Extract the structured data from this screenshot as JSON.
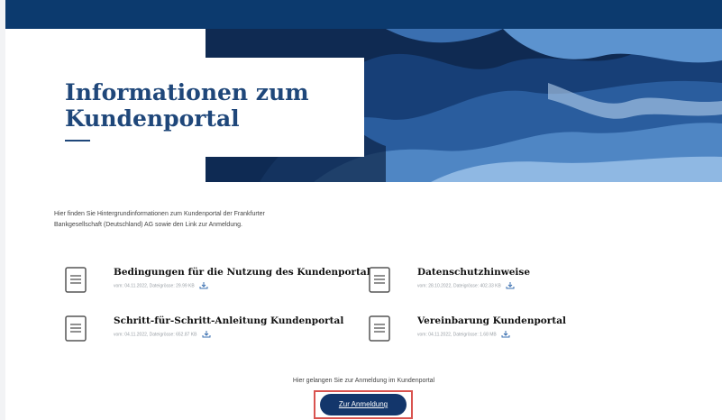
{
  "header": {
    "title_line1": "Informationen zum",
    "title_line2": "Kundenportal"
  },
  "intro": {
    "line1": "Hier finden Sie Hintergrundinformationen zum Kundenportal der Frankfurter",
    "line2": "Bankgesellschaft (Deutschland) AG sowie den Link zur Anmeldung."
  },
  "documents": [
    {
      "title": "Bedingungen für die Nutzung des Kundenportals",
      "meta": "vom: 04.11.2022, Dateigrösse: 29.99 KB",
      "icon": "document-icon",
      "download_icon": "download-icon"
    },
    {
      "title": "Datenschutzhinweise",
      "meta": "vom: 28.10.2022, Dateigrösse: 402.33 KB",
      "icon": "document-icon",
      "download_icon": "download-icon"
    },
    {
      "title": "Schritt-für-Schritt-Anleitung Kundenportal",
      "meta": "vom: 04.11.2022, Dateigrösse: 652.87 KB",
      "icon": "document-icon",
      "download_icon": "download-icon"
    },
    {
      "title": "Vereinbarung Kundenportal",
      "meta": "vom: 04.11.2022, Dateigrösse: 1.68 MB",
      "icon": "document-icon",
      "download_icon": "download-icon"
    }
  ],
  "cta": {
    "text": "Hier gelangen Sie zur Anmeldung im Kundenportal",
    "button_label": "Zur Anmeldung"
  },
  "colors": {
    "brand": "#0c3a6e",
    "title": "#1f477a",
    "button": "#13366b",
    "highlight": "#d9534f"
  }
}
